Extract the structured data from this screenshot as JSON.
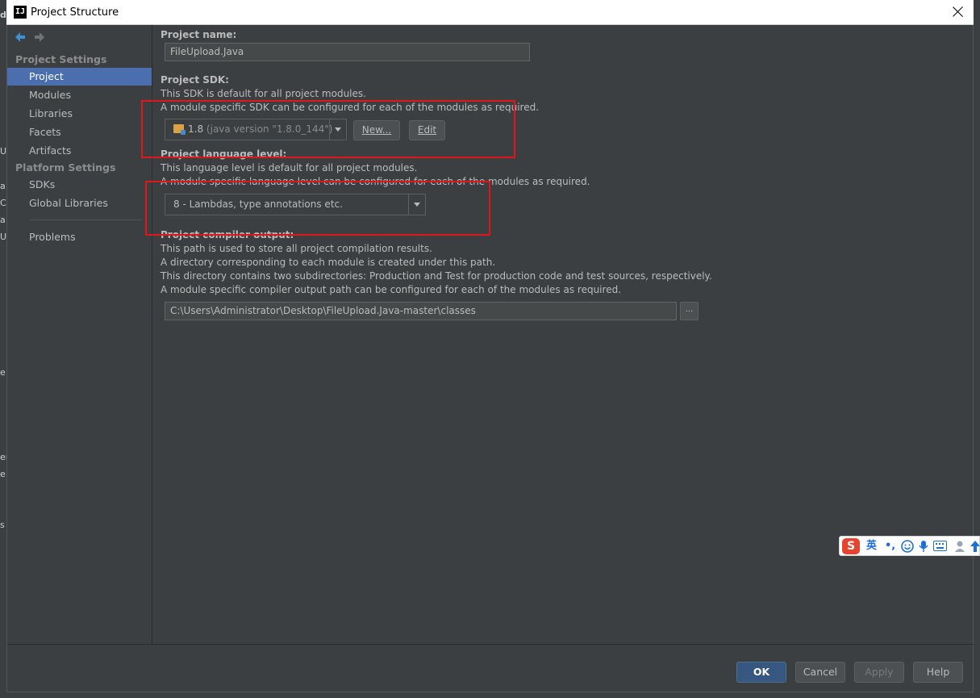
{
  "window": {
    "title": "Project Structure",
    "app_icon_text": "IJ"
  },
  "ide_fragments": [
    "d",
    "U",
    "a",
    "C",
    "a",
    "U",
    "e",
    "er",
    "e",
    "s"
  ],
  "sidebar": {
    "project_settings_label": "Project Settings",
    "platform_settings_label": "Platform Settings",
    "items": [
      {
        "label": "Project",
        "selected": true
      },
      {
        "label": "Modules"
      },
      {
        "label": "Libraries"
      },
      {
        "label": "Facets"
      },
      {
        "label": "Artifacts"
      },
      {
        "label": "SDKs"
      },
      {
        "label": "Global Libraries"
      },
      {
        "label": "Problems"
      }
    ]
  },
  "project_name": {
    "label": "Project name:",
    "value": "FileUpload.Java"
  },
  "project_sdk": {
    "label": "Project SDK:",
    "desc_line1": "This SDK is default for all project modules.",
    "desc_line2": "A module specific SDK can be configured for each of the modules as required.",
    "selected_version": "1.8",
    "selected_detail": "(java version \"1.8.0_144\")",
    "new_button": "New...",
    "edit_button": "Edit"
  },
  "language_level": {
    "label": "Project language level:",
    "desc_line1": "This language level is default for all project modules.",
    "desc_line2": "A module specific language level can be configured for each of the modules as required.",
    "selected": "8 - Lambdas, type annotations etc."
  },
  "compiler_output": {
    "label": "Project compiler output:",
    "desc_line1": "This path is used to store all project compilation results.",
    "desc_line2": "A directory corresponding to each module is created under this path.",
    "desc_line3": "This directory contains two subdirectories: Production and Test for production code and test sources, respectively.",
    "desc_line4": "A module specific compiler output path can be configured for each of the modules as required.",
    "path": "C:\\Users\\Administrator\\Desktop\\FileUpload.Java-master\\classes",
    "browse_label": "..."
  },
  "footer": {
    "ok": "OK",
    "cancel": "Cancel",
    "apply": "Apply",
    "help": "Help"
  },
  "ime_toolbar": {
    "logo": "S",
    "mode": "英",
    "punct": "•,",
    "icons": [
      "emoji-icon",
      "microphone-icon",
      "keyboard-icon",
      "user-icon",
      "skin-icon"
    ]
  },
  "colors": {
    "selection": "#4b6eaf",
    "annotation": "#e0161b",
    "default_button": "#365880",
    "background": "#3c3f41"
  }
}
